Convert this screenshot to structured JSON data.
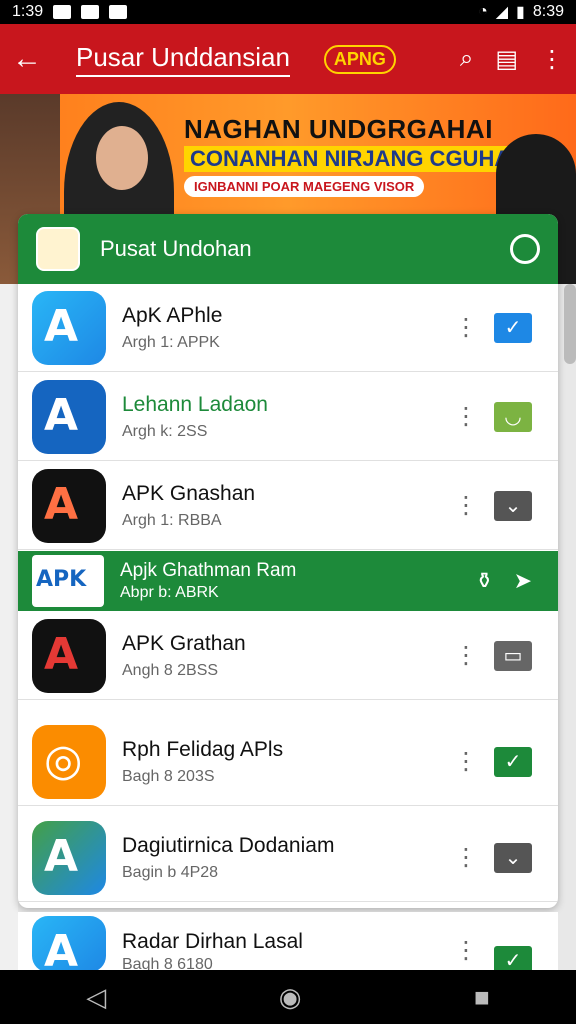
{
  "status": {
    "time": "1:39",
    "right_time": "8:39"
  },
  "appbar": {
    "title": "Pusar Unddansian",
    "badge": "APNG"
  },
  "banner": {
    "line1": "NAGHAN UNDGRGAHAI",
    "line2": "CONANHAN NIRJANG CGUHAR",
    "line3": "IGNBANNI  POAR MAEGENG VISOR"
  },
  "panel": {
    "title": "Pusat Undohan"
  },
  "rows": [
    {
      "name": "ApK APhle",
      "sub": "Argh 1: APPK",
      "color": "#1e88e5",
      "glyph": "A",
      "check": "✓",
      "check_color": "#1e88e5"
    },
    {
      "name": "Lehann Ladaon",
      "sub": "Argh k: 2SS",
      "color": "#1565c0",
      "glyph": "A",
      "check": "◡",
      "check_color": "#7cb342"
    },
    {
      "name": "APK Gnashan",
      "sub": "Argh 1: RBBA",
      "color": "#111111",
      "glyph": "A",
      "check": "⌄",
      "check_color": "#555555"
    },
    {
      "name": "Apjk Ghathman Ram",
      "sub": "Abpr b: ABRK",
      "color": "#ffffff",
      "glyph": "APK"
    },
    {
      "name": "APK Grathan",
      "sub": "Angh 8 2BSS",
      "color": "#111111",
      "glyph": "A",
      "check": "▭",
      "check_color": "#666666"
    },
    {
      "name": "Rph Felidag APls",
      "sub": "Bagh 8 203S",
      "color": "#fb8c00",
      "glyph": "◎",
      "check": "✓",
      "check_color": "#1d8a3a"
    },
    {
      "name": "Dagiutirnica Dodaniam",
      "sub": "Bagin b 4P28",
      "color": "#1e88e5",
      "glyph": "A",
      "check": "⌄",
      "check_color": "#555555"
    },
    {
      "name": "Radar Dirhan Lasal",
      "sub": "Bagh 8 6180",
      "color": "#1e88e5",
      "glyph": "A",
      "check": "✓",
      "check_color": "#1d8a3a"
    }
  ]
}
